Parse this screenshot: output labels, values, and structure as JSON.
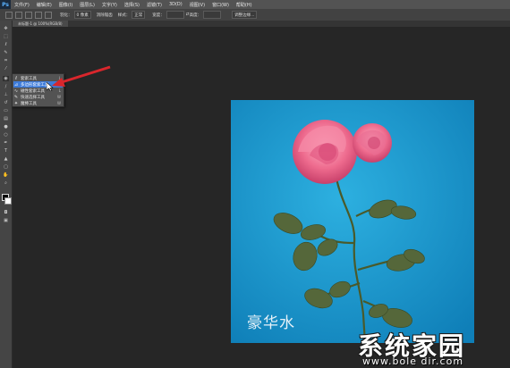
{
  "app": {
    "logo": "Ps"
  },
  "menubar": {
    "items": [
      "文件(F)",
      "编辑(E)",
      "图像(I)",
      "图层(L)",
      "文字(Y)",
      "选择(S)",
      "滤镜(T)",
      "3D(D)",
      "视图(V)",
      "窗口(W)",
      "帮助(H)"
    ]
  },
  "optionsbar": {
    "feather_label": "羽化：",
    "feather_value": "0 像素",
    "antialias_label": "消除锯齿",
    "style_label": "样式：",
    "style_value": "正常",
    "width_label": "宽度：",
    "height_label": "高度：",
    "refine_label": "调整边缘..."
  },
  "document": {
    "tab_title": "未标题-1 @ 100%(RGB/8)"
  },
  "tool_flyout": {
    "items": [
      {
        "icon": "lasso-icon",
        "label": "套索工具",
        "key": "L"
      },
      {
        "icon": "polygon-lasso-icon",
        "label": "多边形套索工具",
        "key": "L"
      },
      {
        "icon": "magnetic-lasso-icon",
        "label": "磁性套索工具",
        "key": "L"
      },
      {
        "icon": "quick-select-icon",
        "label": "快速选择工具",
        "key": "W"
      },
      {
        "icon": "magic-wand-icon",
        "label": "魔棒工具",
        "key": "W"
      }
    ],
    "selected_index": 1
  },
  "canvas": {
    "watermark": "豪华水",
    "background": "#1f9bd0"
  },
  "site_watermark": {
    "name": "系统家园",
    "url": "www.bole dir.com"
  },
  "colors": {
    "accent": "#3d7bd9",
    "arrow": "#d9262c"
  }
}
